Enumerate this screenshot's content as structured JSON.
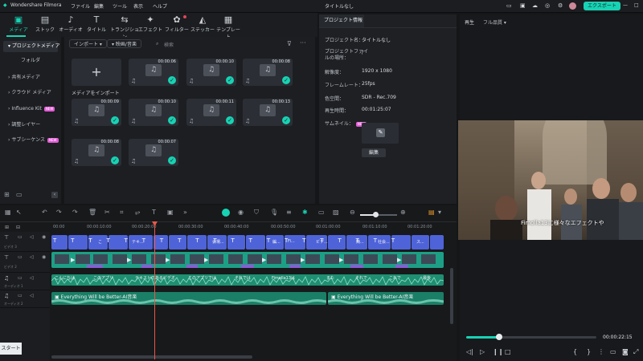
{
  "app": {
    "name": "Wondershare Filmora",
    "project_title": "タイトルなし",
    "export_label": "エクスポート"
  },
  "menu": [
    "ファイル",
    "編集",
    "ツール",
    "表示",
    "ヘルプ"
  ],
  "toolbar": {
    "tools": [
      "メディア",
      "ストック",
      "オーディオ",
      "タイトル",
      "トランジション",
      "エフェクト",
      "フィルター",
      "ステッカー",
      "テンプレート"
    ]
  },
  "sidebar": {
    "items": [
      "プロジェクトメディア",
      "フォルダ",
      "共有メディア",
      "クラウド メディア",
      "Influence Kit",
      "調整レイヤー",
      "サブシーケンス"
    ],
    "new_badge": "NEW"
  },
  "media": {
    "import_dropdown": "インポート",
    "filter_dropdown": "映画/音楽",
    "search_placeholder": "検索",
    "import_label": "メディアをインポート",
    "durations": [
      "00:00:06",
      "00:00:10",
      "00:00:08",
      "00:00:09",
      "00:00:10",
      "00:00:11",
      "00:00:13",
      "00:00:08",
      "00:00:07"
    ]
  },
  "project_info": {
    "tab": "プロジェクト情報",
    "fields": [
      {
        "label": "プロジェクト名：",
        "value": "タイトルなし"
      },
      {
        "label": "プロジェクトファイ\nルの場所：",
        "value": "/"
      },
      {
        "label": "解像度：",
        "value": "1920 x 1080"
      },
      {
        "label": "フレームレート：",
        "value": "25fps"
      },
      {
        "label": "色空間：",
        "value": "SDR - Rec.709"
      },
      {
        "label": "再生時間：",
        "value": "00:01:25:07"
      }
    ],
    "thumbnail_label": "サムネイル：",
    "edit_button": "編集"
  },
  "preview": {
    "tab_play": "再生",
    "quality": "フル品質",
    "subtitle": "Fimolla13に様々なエフェクトや",
    "timecode": "00:00:22:15",
    "progress": 0.25
  },
  "timeline": {
    "ruler": [
      "00:00",
      "00:00:10:00",
      "00:00:20:00",
      "00:00:30:00",
      "00:00:40:00",
      "00:00:50:00",
      "00:01:00:00",
      "00:01:10:00",
      "00:01:20:00"
    ],
    "tracks": [
      "ビデオ 3",
      "ビデオ 2",
      "オーディオ 1",
      "オーディオ 2"
    ],
    "title_clips": [
      "こ",
      "テキ...",
      "会場...",
      "編...",
      "Fi...",
      "ビデ...",
      "簡...",
      "社会...",
      "ス..."
    ],
    "audio1_clips": [
      "こんにちは",
      "このアプリ",
      "テキストのあるビデオ",
      "このアプリでは",
      "それでは",
      "Fimolla13は",
      "また",
      "それで",
      "これで",
      "最後"
    ],
    "music": "Everything Will be Better-AI音楽",
    "start_button": "スタート"
  },
  "colors": {
    "accent": "#18d2b4",
    "title_clip": "#4e63d8",
    "audio": "#1f8f72",
    "playhead": "#e8574a"
  }
}
